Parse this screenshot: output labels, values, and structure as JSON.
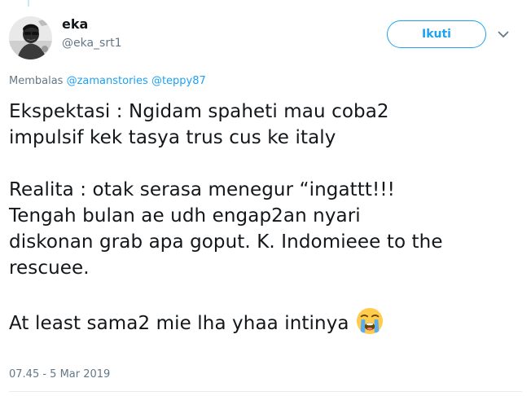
{
  "author": {
    "display_name": "eka",
    "handle": "@eka_srt1"
  },
  "follow_button": {
    "label": "Ikuti"
  },
  "reply_context": {
    "prefix": "Membalas",
    "mentions": [
      "@zamanstories",
      "@teppy87"
    ]
  },
  "tweet": {
    "lines": [
      "Ekspektasi : Ngidam spaheti mau coba2",
      "impulsif kek tasya trus cus ke italy",
      "",
      "Realita : otak serasa menegur “ingattt!!!",
      "Tengah bulan ae udh engap2an nyari",
      "diskonan grab apa goput. K. Indomieee to the",
      "rescuee.",
      "",
      "At least sama2 mie lha yhaa intinya"
    ],
    "emoji": "loudly-crying-face-icon",
    "timestamp": "07.45 - 5 Mar 2019"
  },
  "colors": {
    "accent": "#1da1f2",
    "text": "#14171a",
    "muted": "#657786"
  }
}
